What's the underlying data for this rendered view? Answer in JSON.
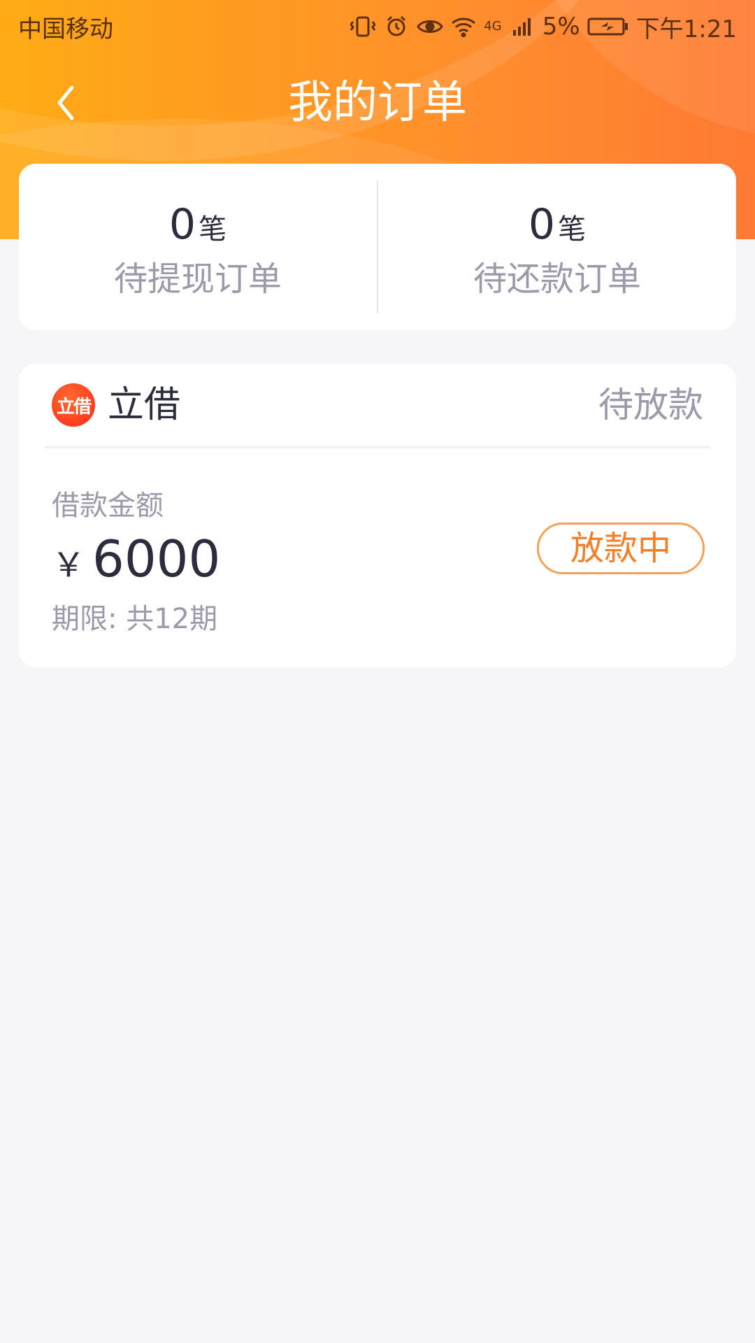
{
  "status_bar": {
    "carrier": "中国移动",
    "network": "4G",
    "battery": "5%",
    "time": "下午1:21",
    "icons": [
      "vibrate-icon",
      "alarm-icon",
      "eye-icon",
      "wifi-icon",
      "signal-icon",
      "battery-icon"
    ]
  },
  "title_bar": {
    "title": "我的订单",
    "back_icon": "chevron-left-icon"
  },
  "summary": {
    "items": [
      {
        "count": "0",
        "unit": "笔",
        "label": "待提现订单"
      },
      {
        "count": "0",
        "unit": "笔",
        "label": "待还款订单"
      }
    ]
  },
  "order": {
    "brand_logo_text": "立借",
    "brand_name": "立借",
    "status": "待放款",
    "amount_label": "借款金额",
    "currency_symbol": "￥",
    "amount": "6000",
    "term": "期限: 共12期",
    "action_status": "放款中"
  },
  "colors": {
    "header_gradient_start": "#ffab15",
    "header_gradient_end": "#ff7a32",
    "text_primary": "#2c2d3c",
    "text_secondary": "#9a9aab",
    "pill_border": "#f0a45b",
    "pill_text": "#f47f2a",
    "background": "#f6f6f8"
  }
}
